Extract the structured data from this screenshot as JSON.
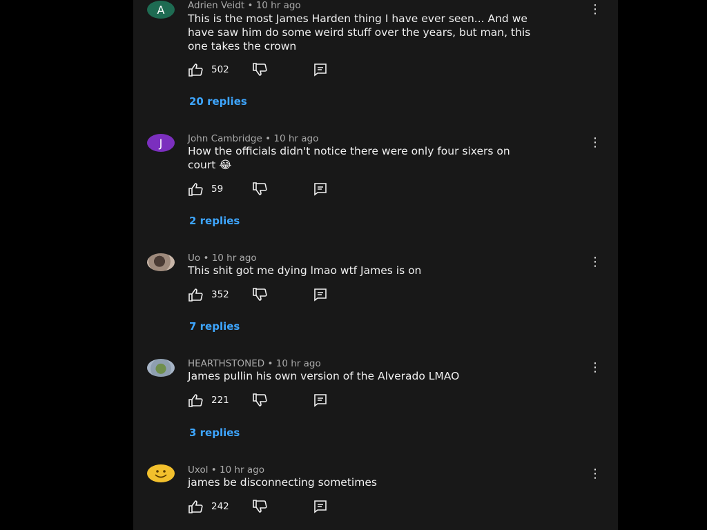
{
  "comments": [
    {
      "avatar_letter": "A",
      "author": "Adrien Veidt",
      "time": "10 hr ago",
      "text_lines": [
        "This is the most James Harden thing I have ever seen... And we",
        "have saw him do some weird stuff over the years, but man, this",
        "one takes the crown"
      ],
      "likes": "502",
      "replies": "20 replies"
    },
    {
      "avatar_letter": "J",
      "author": "John Cambridge",
      "time": "10 hr ago",
      "text_lines": [
        "How the officials didn't notice  there were only four sixers on",
        "court 😂"
      ],
      "likes": "59",
      "replies": "2 replies"
    },
    {
      "avatar_letter": "",
      "author": "Uo",
      "time": "10 hr ago",
      "text_lines": [
        "This shit got me dying lmao wtf James is on"
      ],
      "likes": "352",
      "replies": "7 replies"
    },
    {
      "avatar_letter": "",
      "author": "HEARTHSTONED",
      "time": "10 hr ago",
      "text_lines": [
        "James pullin his own version of the Alverado LMAO"
      ],
      "likes": "221",
      "replies": "3 replies"
    },
    {
      "avatar_letter": "",
      "author": "Uxol",
      "time": "10 hr ago",
      "text_lines": [
        "james be disconnecting sometimes"
      ],
      "likes": "242"
    }
  ],
  "colors": {
    "panel_bg": "#181818",
    "link_blue": "#3ea6ff",
    "meta_gray": "#aaaaaa",
    "text": "#f1f1f1"
  },
  "icons": {
    "like": "thumbs-up-icon",
    "dislike": "thumbs-down-icon",
    "reply": "comment-icon",
    "menu": "more-vert-icon"
  }
}
